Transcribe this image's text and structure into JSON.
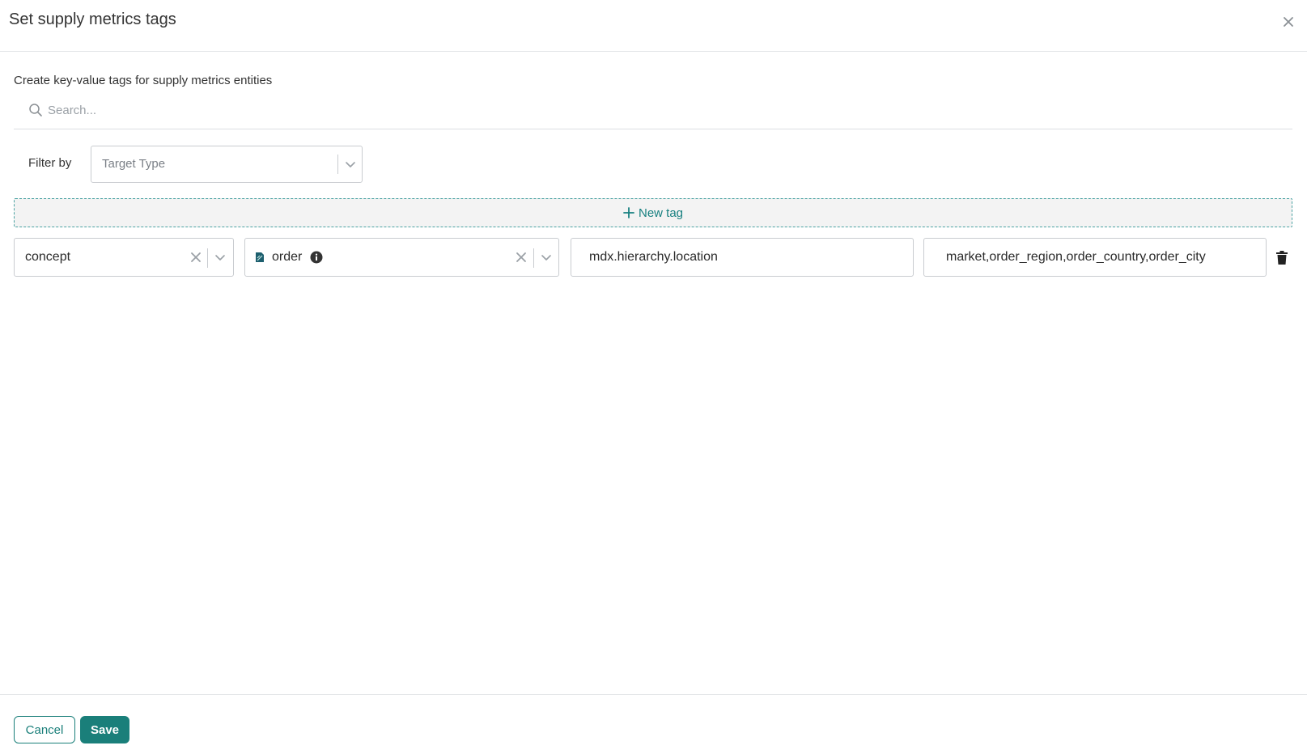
{
  "dialog": {
    "title": "Set supply metrics tags",
    "subtitle": "Create key-value tags for supply metrics entities"
  },
  "search": {
    "placeholder": "Search...",
    "value": ""
  },
  "filter": {
    "label": "Filter by",
    "selected": "Target Type"
  },
  "new_tag": {
    "label": "New tag"
  },
  "tag_row": {
    "target_type": "concept",
    "target": "order",
    "key": "mdx.hierarchy.location",
    "value": "market,order_region,order_country,order_city"
  },
  "footer": {
    "cancel_label": "Cancel",
    "save_label": "Save"
  },
  "colors": {
    "accent": "#1a7f7a",
    "accent_text": "#178080",
    "border": "#c9ccd0"
  },
  "icons": {
    "close": "close-icon",
    "search": "search-icon",
    "chevron": "chevron-down-icon",
    "clear": "clear-icon",
    "plus": "plus-icon",
    "concept": "concept-icon",
    "info": "info-icon",
    "trash": "trash-icon"
  }
}
